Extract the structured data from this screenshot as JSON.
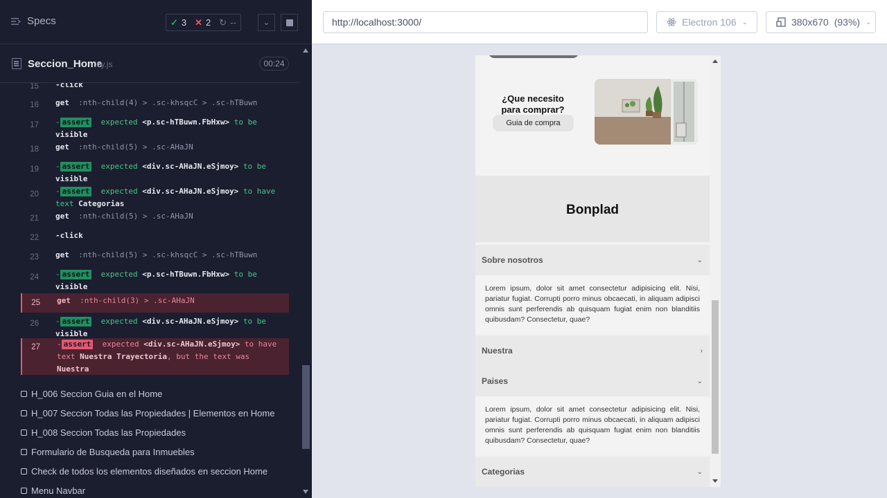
{
  "reporter": {
    "specs_label": "Specs",
    "stats": {
      "passed": "3",
      "failed": "2",
      "pending": "--"
    },
    "file": {
      "name": "Seccion_Home",
      "ext": ".cy.js",
      "duration": "00:24"
    },
    "commands": [
      {
        "num": "15",
        "text": "-click"
      },
      {
        "num": "16",
        "cmd": "get",
        "selector": ":nth-child(4) > .sc-khsqcC > .sc-hTBuwn"
      },
      {
        "num": "17",
        "prefix": "-",
        "tag": "assert",
        "expected": "expected",
        "subject": "<p.sc-hTBuwn.FbHxw>",
        "mid": "to be",
        "tail": "visible"
      },
      {
        "num": "18",
        "cmd": "get",
        "selector": ":nth-child(5) > .sc-AHaJN"
      },
      {
        "num": "19",
        "prefix": "-",
        "tag": "assert",
        "expected": "expected",
        "subject": "<div.sc-AHaJN.eSjmoy>",
        "mid": "to be",
        "tail": "visible"
      },
      {
        "num": "20",
        "prefix": "-",
        "tag": "assert",
        "expected": "expected",
        "subject": "<div.sc-AHaJN.eSjmoy>",
        "mid": "to have",
        "tail_pre": "text",
        "tail_val": "Categorias"
      },
      {
        "num": "21",
        "cmd": "get",
        "selector": ":nth-child(5) > .sc-AHaJN"
      },
      {
        "num": "22",
        "text": "-click"
      },
      {
        "num": "23",
        "cmd": "get",
        "selector": ":nth-child(5) > .sc-khsqcC > .sc-hTBuwn"
      },
      {
        "num": "24",
        "prefix": "-",
        "tag": "assert",
        "expected": "expected",
        "subject": "<p.sc-hTBuwn.FbHxw>",
        "mid": "to be",
        "tail": "visible"
      },
      {
        "num": "25",
        "cmd": "get",
        "selector": ":nth-child(3) > .sc-AHaJN"
      },
      {
        "num": "26",
        "prefix": "-",
        "tag": "assert",
        "expected": "expected",
        "subject": "<div.sc-AHaJN.eSjmoy>",
        "mid": "to be",
        "tail": "visible"
      },
      {
        "num": "27",
        "prefix": "-",
        "tag": "assert",
        "expected": "expected",
        "subject": "<div.sc-AHaJN.eSjmoy>",
        "mid": "to have",
        "tail_pre": "text",
        "tail_val": "Nuestra Trayectoria",
        "tail_post": ", but the text was",
        "tail_last": "Nuestra"
      }
    ],
    "tests": [
      "H_006 Seccion Guia en el Home",
      "H_007 Seccion Todas las Propiedades | Elementos en Home",
      "H_008 Seccion Todas las Propiedades",
      "Formulario de Busqueda para Inmuebles",
      "Check de todos los elementos diseñados en seccion Home",
      "Menu Navbar"
    ]
  },
  "aut": {
    "url": "http://localhost:3000/",
    "browser": "Electron 106",
    "viewport": "380x670",
    "zoom": "(93%)"
  },
  "app": {
    "guide_title": "¿Que necesito para comprar?",
    "guide_button": "Guia de compra",
    "brand": "Bonplad",
    "accordion": [
      {
        "title": "Sobre nosotros",
        "state": "open",
        "body": "Lorem ipsum, dolor sit amet consectetur adipisicing elit. Nisi, pariatur fugiat. Corrupti porro minus obcaecati, in aliquam adipisci omnis sunt perferendis ab quisquam fugiat enim non blanditiis quibusdam? Consectetur, quae?"
      },
      {
        "title": "Nuestra",
        "state": "closed"
      },
      {
        "title": "Paises",
        "state": "open",
        "body": "Lorem ipsum, dolor sit amet consectetur adipisicing elit. Nisi, pariatur fugiat. Corrupti porro minus obcaecati, in aliquam adipisci omnis sunt perferendis ab quisquam fugiat enim non blanditiis quibusdam? Consectetur, quae?"
      },
      {
        "title": "Categorias",
        "state": "open"
      }
    ]
  },
  "colors": {
    "reporter_bg": "#1b1e2e",
    "pass": "#1fa971",
    "fail": "#e45770",
    "aut_bg": "#e1e3ed"
  }
}
